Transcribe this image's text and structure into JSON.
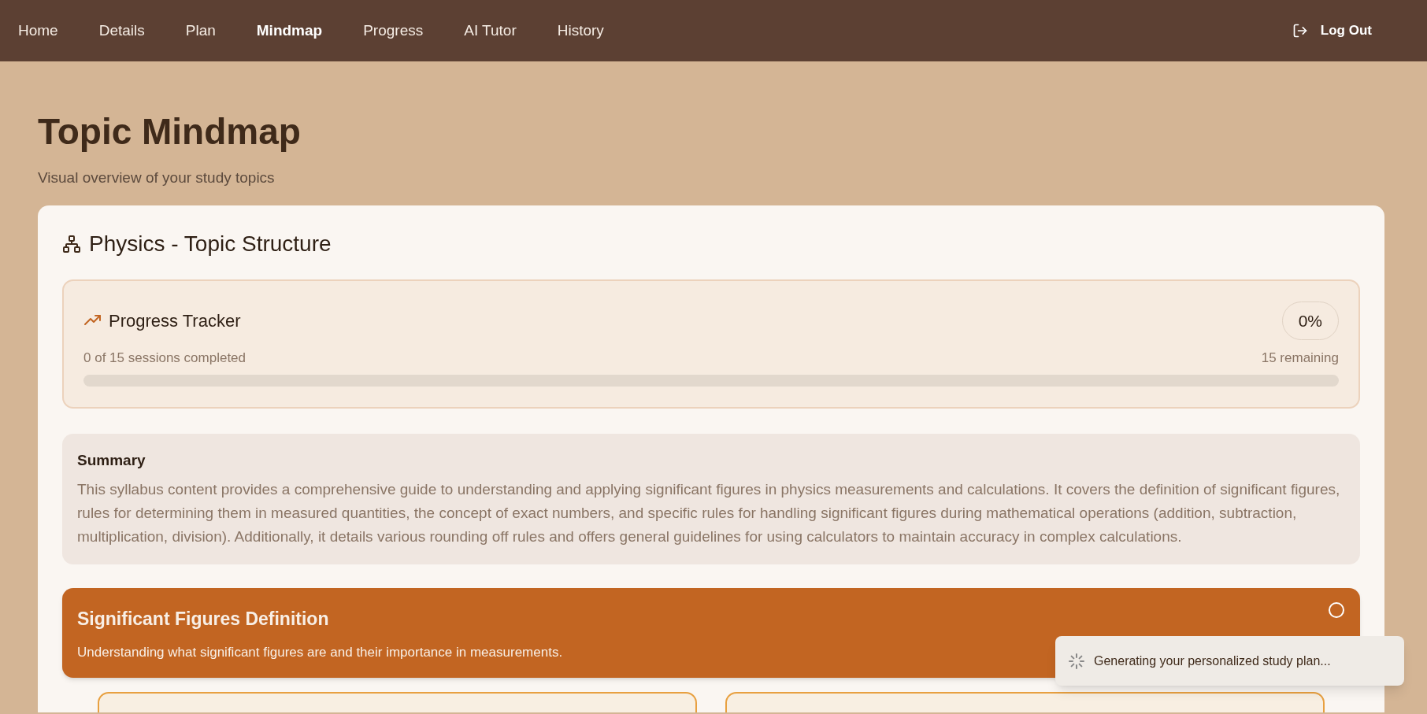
{
  "nav": {
    "items": [
      {
        "label": "Home",
        "selected": false
      },
      {
        "label": "Details",
        "selected": false
      },
      {
        "label": "Plan",
        "selected": false
      },
      {
        "label": "Mindmap",
        "selected": true
      },
      {
        "label": "Progress",
        "selected": false
      },
      {
        "label": "AI Tutor",
        "selected": false
      },
      {
        "label": "History",
        "selected": false
      }
    ],
    "logout": "Log Out"
  },
  "page": {
    "title": "Topic Mindmap",
    "subtitle": "Visual overview of your study topics"
  },
  "structure": {
    "title": "Physics - Topic Structure",
    "progress": {
      "title": "Progress Tracker",
      "percent": "0%",
      "completed_text": "0 of 15 sessions completed",
      "remaining_text": "15 remaining",
      "level": 0
    },
    "summary": {
      "title": "Summary",
      "text": "This syllabus content provides a comprehensive guide to understanding and applying significant figures in physics measurements and calculations. It covers the definition of significant figures, rules for determining them in measured quantities, the concept of exact numbers, and specific rules for handling significant figures during mathematical operations (addition, subtraction, multiplication, division). Additionally, it details various rounding off rules and offers general guidelines for using calculators to maintain accuracy in complex calculations."
    },
    "topics": [
      {
        "title": "Significant Figures Definition",
        "description": "Understanding what significant figures are and their importance in measurements.",
        "completed": false
      }
    ]
  },
  "toast": {
    "text": "Generating your personalized study plan..."
  }
}
